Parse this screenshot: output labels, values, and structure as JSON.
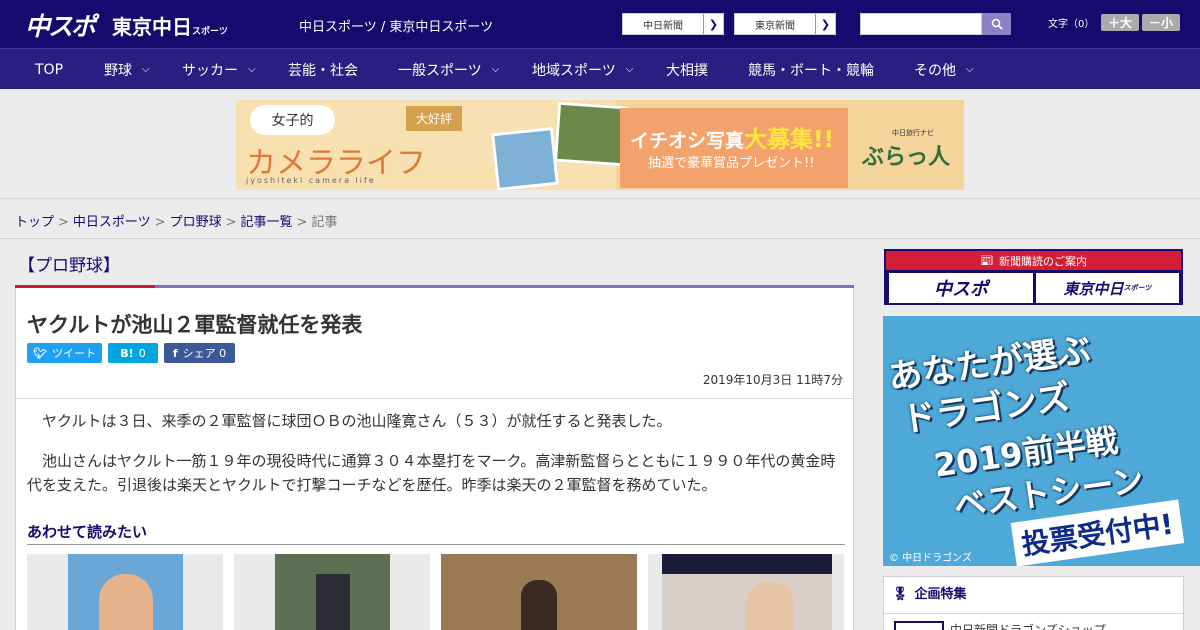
{
  "header": {
    "logo_chunichi": "中スポ",
    "logo_tokyo": "東京中日",
    "logo_tokyo_small": "スポーツ",
    "site_names": "中日スポーツ / 東京中日スポーツ",
    "news_buttons": [
      "中日新聞",
      "東京新聞"
    ],
    "search_placeholder": "",
    "font_size_label": "文字（0）",
    "font_larger": "＋大",
    "font_smaller": "－小"
  },
  "nav": {
    "items": [
      {
        "label": "TOP",
        "has_menu": false
      },
      {
        "label": "野球",
        "has_menu": true
      },
      {
        "label": "サッカー",
        "has_menu": true
      },
      {
        "label": "芸能・社会",
        "has_menu": false
      },
      {
        "label": "一般スポーツ",
        "has_menu": true
      },
      {
        "label": "地域スポーツ",
        "has_menu": true
      },
      {
        "label": "大相撲",
        "has_menu": false
      },
      {
        "label": "競馬・ボート・競輪",
        "has_menu": false
      },
      {
        "label": "その他",
        "has_menu": true
      }
    ]
  },
  "banner": {
    "joshi": "女子的",
    "camera_life": "カメラライフ",
    "sub": "jyoshiteki camera life",
    "daikohyo": "大好評",
    "ichioshi": "イチオシ写真",
    "daiboshu": "大募集!!",
    "prize": "抽選で豪華賞品プレゼント!!",
    "brand_small": "中日旅行ナビ",
    "brand": "ぶらっ人"
  },
  "breadcrumb": {
    "items": [
      "トップ",
      "中日スポーツ",
      "プロ野球",
      "記事一覧"
    ],
    "current": "記事"
  },
  "article": {
    "category": "【プロ野球】",
    "title": "ヤクルトが池山２軍監督就任を発表",
    "tweet_label": "ツイート",
    "hatena_count": "0",
    "share_label": "シェア",
    "share_count": "0",
    "date": "2019年10月3日 11時7分",
    "paragraphs": [
      "　ヤクルトは３日、来季の２軍監督に球団ＯＢの池山隆寛さん（５３）が就任すると発表した。",
      "　池山さんはヤクルト一筋１９年の現役時代に通算３０４本塁打をマーク。高津新監督らとともに１９９０年代の黄金時代を支えた。引退後は楽天とヤクルトで打撃コーチなどを歴任。昨季は楽天の２軍監督を務めていた。"
    ],
    "related_heading": "あわせて読みたい"
  },
  "sidebar": {
    "subscription_heading": "新聞購読のご案内",
    "subscription_options": [
      "中スポ",
      "東京中日"
    ],
    "subscription_small": "スポーツ",
    "ad_lines": [
      "あなたが選ぶ",
      "ドラゴンズ",
      "2019前半戦",
      "ベストシーン"
    ],
    "ad_vote": "投票受付中!",
    "ad_copyright": "© 中日ドラゴンズ",
    "special_heading": "企画特集",
    "special_item": "中日新聞ドラゴンズショップ"
  },
  "colors": {
    "header_bg": "#150a6e",
    "nav_bg": "#2a1f80",
    "accent_red": "#c71a2c"
  }
}
